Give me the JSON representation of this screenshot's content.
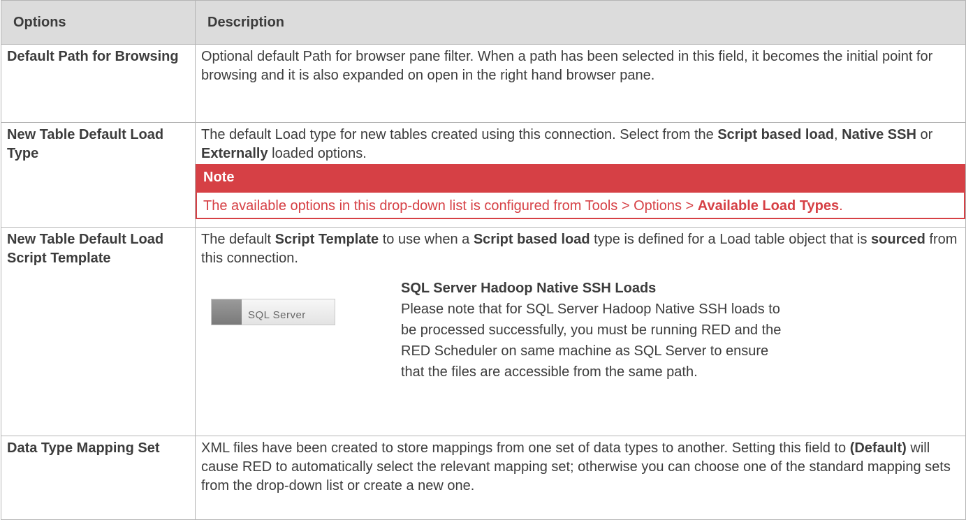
{
  "headers": {
    "options": "Options",
    "description": "Description"
  },
  "rows": [
    {
      "option": "Default Path for Browsing",
      "description": " Optional default Path for browser pane filter. When a path has been selected in this field, it becomes the initial point for browsing and it is also expanded on open in the right hand browser pane."
    },
    {
      "option": "New Table Default Load Type",
      "desc_part1": "The default Load type for new tables created using this connection. Select from the ",
      "desc_b1": "Script based load",
      "desc_part2": ", ",
      "desc_b2": "Native SSH",
      "desc_part3": " or ",
      "desc_b3": "Externally",
      "desc_part4": " loaded options.",
      "note_title": "Note",
      "note_text": " The available options in this drop-down list is configured from Tools > Options > ",
      "note_bold": "Available Load Types",
      "note_end": "."
    },
    {
      "option": "New Table Default Load Script Template",
      "desc_part1": "The default ",
      "desc_b1": "Script Template",
      "desc_part2": " to use when a ",
      "desc_b2": "Script based load",
      "desc_part3": " type is defined for a Load table object that is ",
      "desc_b3": "sourced",
      "desc_part4": " from this connection.",
      "logo_text": "SQL Server",
      "sql_title": "SQL Server  Hadoop Native SSH Loads",
      "sql_text": "Please note that for SQL Server Hadoop Native SSH loads to be processed successfully, you must be running RED and the RED Scheduler on same machine as SQL Server to ensure that the files are accessible from the same path."
    },
    {
      "option": "Data Type Mapping Set",
      "desc_part1": " XML files have been created to store mappings from one set of data types to another. Setting this field to ",
      "desc_b1": "(Default)",
      "desc_part2": " will cause RED to automatically select the relevant mapping set; otherwise you can choose one of the standard mapping sets from the drop-down list or create a new one."
    }
  ],
  "colors": {
    "header_bg": "#dcdcdc",
    "note_red": "#d64045",
    "text": "#3c3c3c",
    "border": "#b5b5b5"
  }
}
